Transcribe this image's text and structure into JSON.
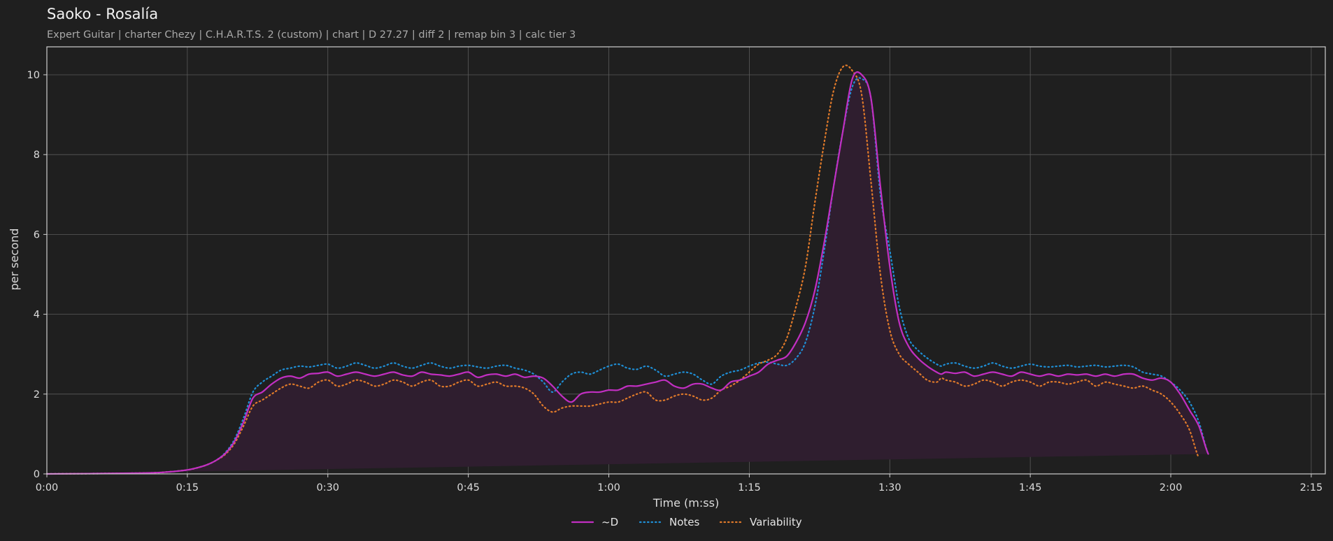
{
  "header": {
    "title": "Saoko - Rosalía",
    "subtitle": "Expert Guitar  |  charter Chezy  |  C.H.A.R.T.S. 2 (custom)  |  chart  |  D 27.27  |  diff 2  |  remap bin 3  |  calc tier 3"
  },
  "colors": {
    "background": "#1f1f1f",
    "d_line": "#c22fc2",
    "notes_line": "#1f8fd6",
    "variability_line": "#e07a2a",
    "fill": "#2f1e2f",
    "grid": "#5a5a5a",
    "frame": "#cfcfcf"
  },
  "chart_data": {
    "type": "line",
    "title": "Saoko - Rosalía",
    "xlabel": "Time (m:ss)",
    "ylabel": "per second",
    "xlim": [
      0,
      136.5
    ],
    "ylim": [
      0,
      10.7
    ],
    "grid": true,
    "legend_position": "bottom-center",
    "x_ticks": [
      {
        "value": 0,
        "label": "0:00"
      },
      {
        "value": 15,
        "label": "0:15"
      },
      {
        "value": 30,
        "label": "0:30"
      },
      {
        "value": 45,
        "label": "0:45"
      },
      {
        "value": 60,
        "label": "1:00"
      },
      {
        "value": 75,
        "label": "1:15"
      },
      {
        "value": 90,
        "label": "1:30"
      },
      {
        "value": 105,
        "label": "1:45"
      },
      {
        "value": 120,
        "label": "2:00"
      },
      {
        "value": 135,
        "label": "2:15"
      }
    ],
    "y_ticks": [
      {
        "value": 0,
        "label": "0"
      },
      {
        "value": 2,
        "label": "2"
      },
      {
        "value": 4,
        "label": "4"
      },
      {
        "value": 6,
        "label": "6"
      },
      {
        "value": 8,
        "label": "8"
      },
      {
        "value": 10,
        "label": "10"
      }
    ],
    "x": [
      0,
      10,
      13,
      15,
      16,
      17,
      18,
      19,
      20,
      21,
      22,
      23,
      24,
      25,
      26,
      27,
      28,
      29,
      30,
      31,
      32,
      33,
      34,
      35,
      36,
      37,
      38,
      39,
      40,
      41,
      42,
      43,
      44,
      45,
      46,
      47,
      48,
      49,
      50,
      51,
      52,
      53,
      54,
      55,
      56,
      57,
      58,
      59,
      60,
      61,
      62,
      63,
      64,
      65,
      66,
      67,
      68,
      69,
      70,
      71,
      72,
      73,
      74,
      75,
      76,
      77,
      78,
      79,
      80,
      81,
      82,
      83,
      84,
      85,
      86,
      87,
      88,
      89,
      90,
      91,
      92,
      93,
      94,
      95,
      95.5,
      96,
      97,
      98,
      99,
      100,
      101,
      102,
      103,
      104,
      105,
      106,
      107,
      108,
      109,
      110,
      111,
      112,
      113,
      114,
      115,
      116,
      117,
      118,
      119,
      120,
      121,
      122,
      123,
      124,
      125,
      126,
      127,
      128,
      129,
      130,
      131,
      132,
      133,
      134,
      135,
      136,
      136.5
    ],
    "series": [
      {
        "name": "~D",
        "style": "solid",
        "values": [
          0,
          0.02,
          0.05,
          0.1,
          0.15,
          0.22,
          0.33,
          0.5,
          0.8,
          1.3,
          1.9,
          2.05,
          2.25,
          2.4,
          2.45,
          2.4,
          2.5,
          2.52,
          2.55,
          2.45,
          2.5,
          2.55,
          2.5,
          2.45,
          2.5,
          2.55,
          2.48,
          2.45,
          2.55,
          2.5,
          2.48,
          2.45,
          2.5,
          2.55,
          2.42,
          2.48,
          2.5,
          2.45,
          2.5,
          2.42,
          2.45,
          2.4,
          2.2,
          1.95,
          1.8,
          2.0,
          2.05,
          2.05,
          2.1,
          2.1,
          2.2,
          2.2,
          2.25,
          2.3,
          2.35,
          2.2,
          2.15,
          2.25,
          2.25,
          2.15,
          2.1,
          2.3,
          2.35,
          2.45,
          2.55,
          2.75,
          2.85,
          2.95,
          3.3,
          3.8,
          4.6,
          5.8,
          7.2,
          8.6,
          9.9,
          10.0,
          9.4,
          7.2,
          5.2,
          3.8,
          3.2,
          2.9,
          2.7,
          2.55,
          2.5,
          2.55,
          2.52,
          2.55,
          2.45,
          2.5,
          2.55,
          2.5,
          2.45,
          2.55,
          2.5,
          2.45,
          2.5,
          2.45,
          2.5,
          2.48,
          2.5,
          2.45,
          2.5,
          2.45,
          2.5,
          2.5,
          2.4,
          2.35,
          2.4,
          2.3,
          2.0,
          1.6,
          1.2,
          0.5,
          0.2
        ]
      },
      {
        "name": "Notes",
        "style": "dotted",
        "values": [
          0,
          0.02,
          0.05,
          0.1,
          0.15,
          0.22,
          0.33,
          0.52,
          0.85,
          1.4,
          2.05,
          2.3,
          2.45,
          2.6,
          2.65,
          2.7,
          2.68,
          2.72,
          2.75,
          2.65,
          2.7,
          2.78,
          2.72,
          2.65,
          2.7,
          2.78,
          2.7,
          2.65,
          2.72,
          2.78,
          2.7,
          2.65,
          2.7,
          2.72,
          2.68,
          2.65,
          2.7,
          2.72,
          2.65,
          2.6,
          2.5,
          2.3,
          2.05,
          2.3,
          2.5,
          2.55,
          2.5,
          2.6,
          2.7,
          2.75,
          2.65,
          2.62,
          2.7,
          2.6,
          2.45,
          2.5,
          2.55,
          2.5,
          2.35,
          2.25,
          2.45,
          2.55,
          2.6,
          2.7,
          2.78,
          2.8,
          2.75,
          2.72,
          2.9,
          3.3,
          4.2,
          5.6,
          7.2,
          8.6,
          9.7,
          9.9,
          9.4,
          7.0,
          5.6,
          4.2,
          3.4,
          3.1,
          2.9,
          2.75,
          2.7,
          2.75,
          2.78,
          2.7,
          2.65,
          2.7,
          2.78,
          2.7,
          2.65,
          2.7,
          2.75,
          2.7,
          2.68,
          2.7,
          2.72,
          2.68,
          2.7,
          2.72,
          2.68,
          2.7,
          2.72,
          2.68,
          2.55,
          2.5,
          2.45,
          2.3,
          2.1,
          1.8,
          1.3,
          0.5,
          0.2
        ]
      },
      {
        "name": "Variability",
        "style": "dotted",
        "values": [
          0,
          0.02,
          0.05,
          0.1,
          0.15,
          0.22,
          0.33,
          0.48,
          0.75,
          1.2,
          1.7,
          1.85,
          2.0,
          2.15,
          2.25,
          2.2,
          2.15,
          2.3,
          2.35,
          2.2,
          2.25,
          2.35,
          2.3,
          2.2,
          2.25,
          2.35,
          2.3,
          2.2,
          2.3,
          2.35,
          2.2,
          2.2,
          2.3,
          2.35,
          2.2,
          2.25,
          2.3,
          2.2,
          2.2,
          2.15,
          2.0,
          1.7,
          1.55,
          1.65,
          1.7,
          1.7,
          1.7,
          1.75,
          1.8,
          1.8,
          1.9,
          2.0,
          2.05,
          1.85,
          1.85,
          1.95,
          2.0,
          1.95,
          1.85,
          1.9,
          2.1,
          2.2,
          2.35,
          2.55,
          2.75,
          2.85,
          3.0,
          3.4,
          4.2,
          5.2,
          6.8,
          8.3,
          9.6,
          10.2,
          10.1,
          9.5,
          7.3,
          5.0,
          3.6,
          3.0,
          2.75,
          2.55,
          2.35,
          2.3,
          2.4,
          2.35,
          2.3,
          2.2,
          2.25,
          2.35,
          2.3,
          2.2,
          2.3,
          2.35,
          2.3,
          2.2,
          2.3,
          2.3,
          2.25,
          2.3,
          2.35,
          2.2,
          2.3,
          2.25,
          2.2,
          2.15,
          2.2,
          2.1,
          2.0,
          1.8,
          1.5,
          1.1,
          0.4,
          0.15
        ]
      }
    ]
  }
}
